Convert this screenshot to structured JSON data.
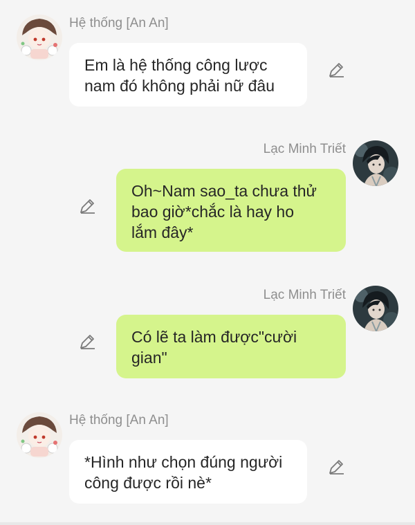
{
  "colors": {
    "background": "#f5f5f5",
    "incoming_bubble": "#ffffff",
    "outgoing_bubble": "#d5f48c",
    "sender_name": "#8e8e8e",
    "text": "#262626"
  },
  "messages": [
    {
      "sender": "Hệ thống [An An]",
      "side": "left",
      "text": "Em là hệ thống công lược\nnam đó không phải nữ đâu",
      "icon": "edit-pencil-icon"
    },
    {
      "sender": "Lạc Minh Triết",
      "side": "right",
      "text": "Oh~Nam sao_ta chưa thử\nbao giờ*chắc là hay ho\nlắm đây*",
      "icon": "edit-pencil-icon"
    },
    {
      "sender": "Lạc Minh Triết",
      "side": "right",
      "text": "Có lẽ ta làm được\"cười\ngian\"",
      "icon": "edit-pencil-icon"
    },
    {
      "sender": "Hệ thống [An An]",
      "side": "left",
      "text": "*Hình như chọn đúng người\ncông được rồi nè*",
      "icon": "edit-pencil-icon"
    }
  ]
}
